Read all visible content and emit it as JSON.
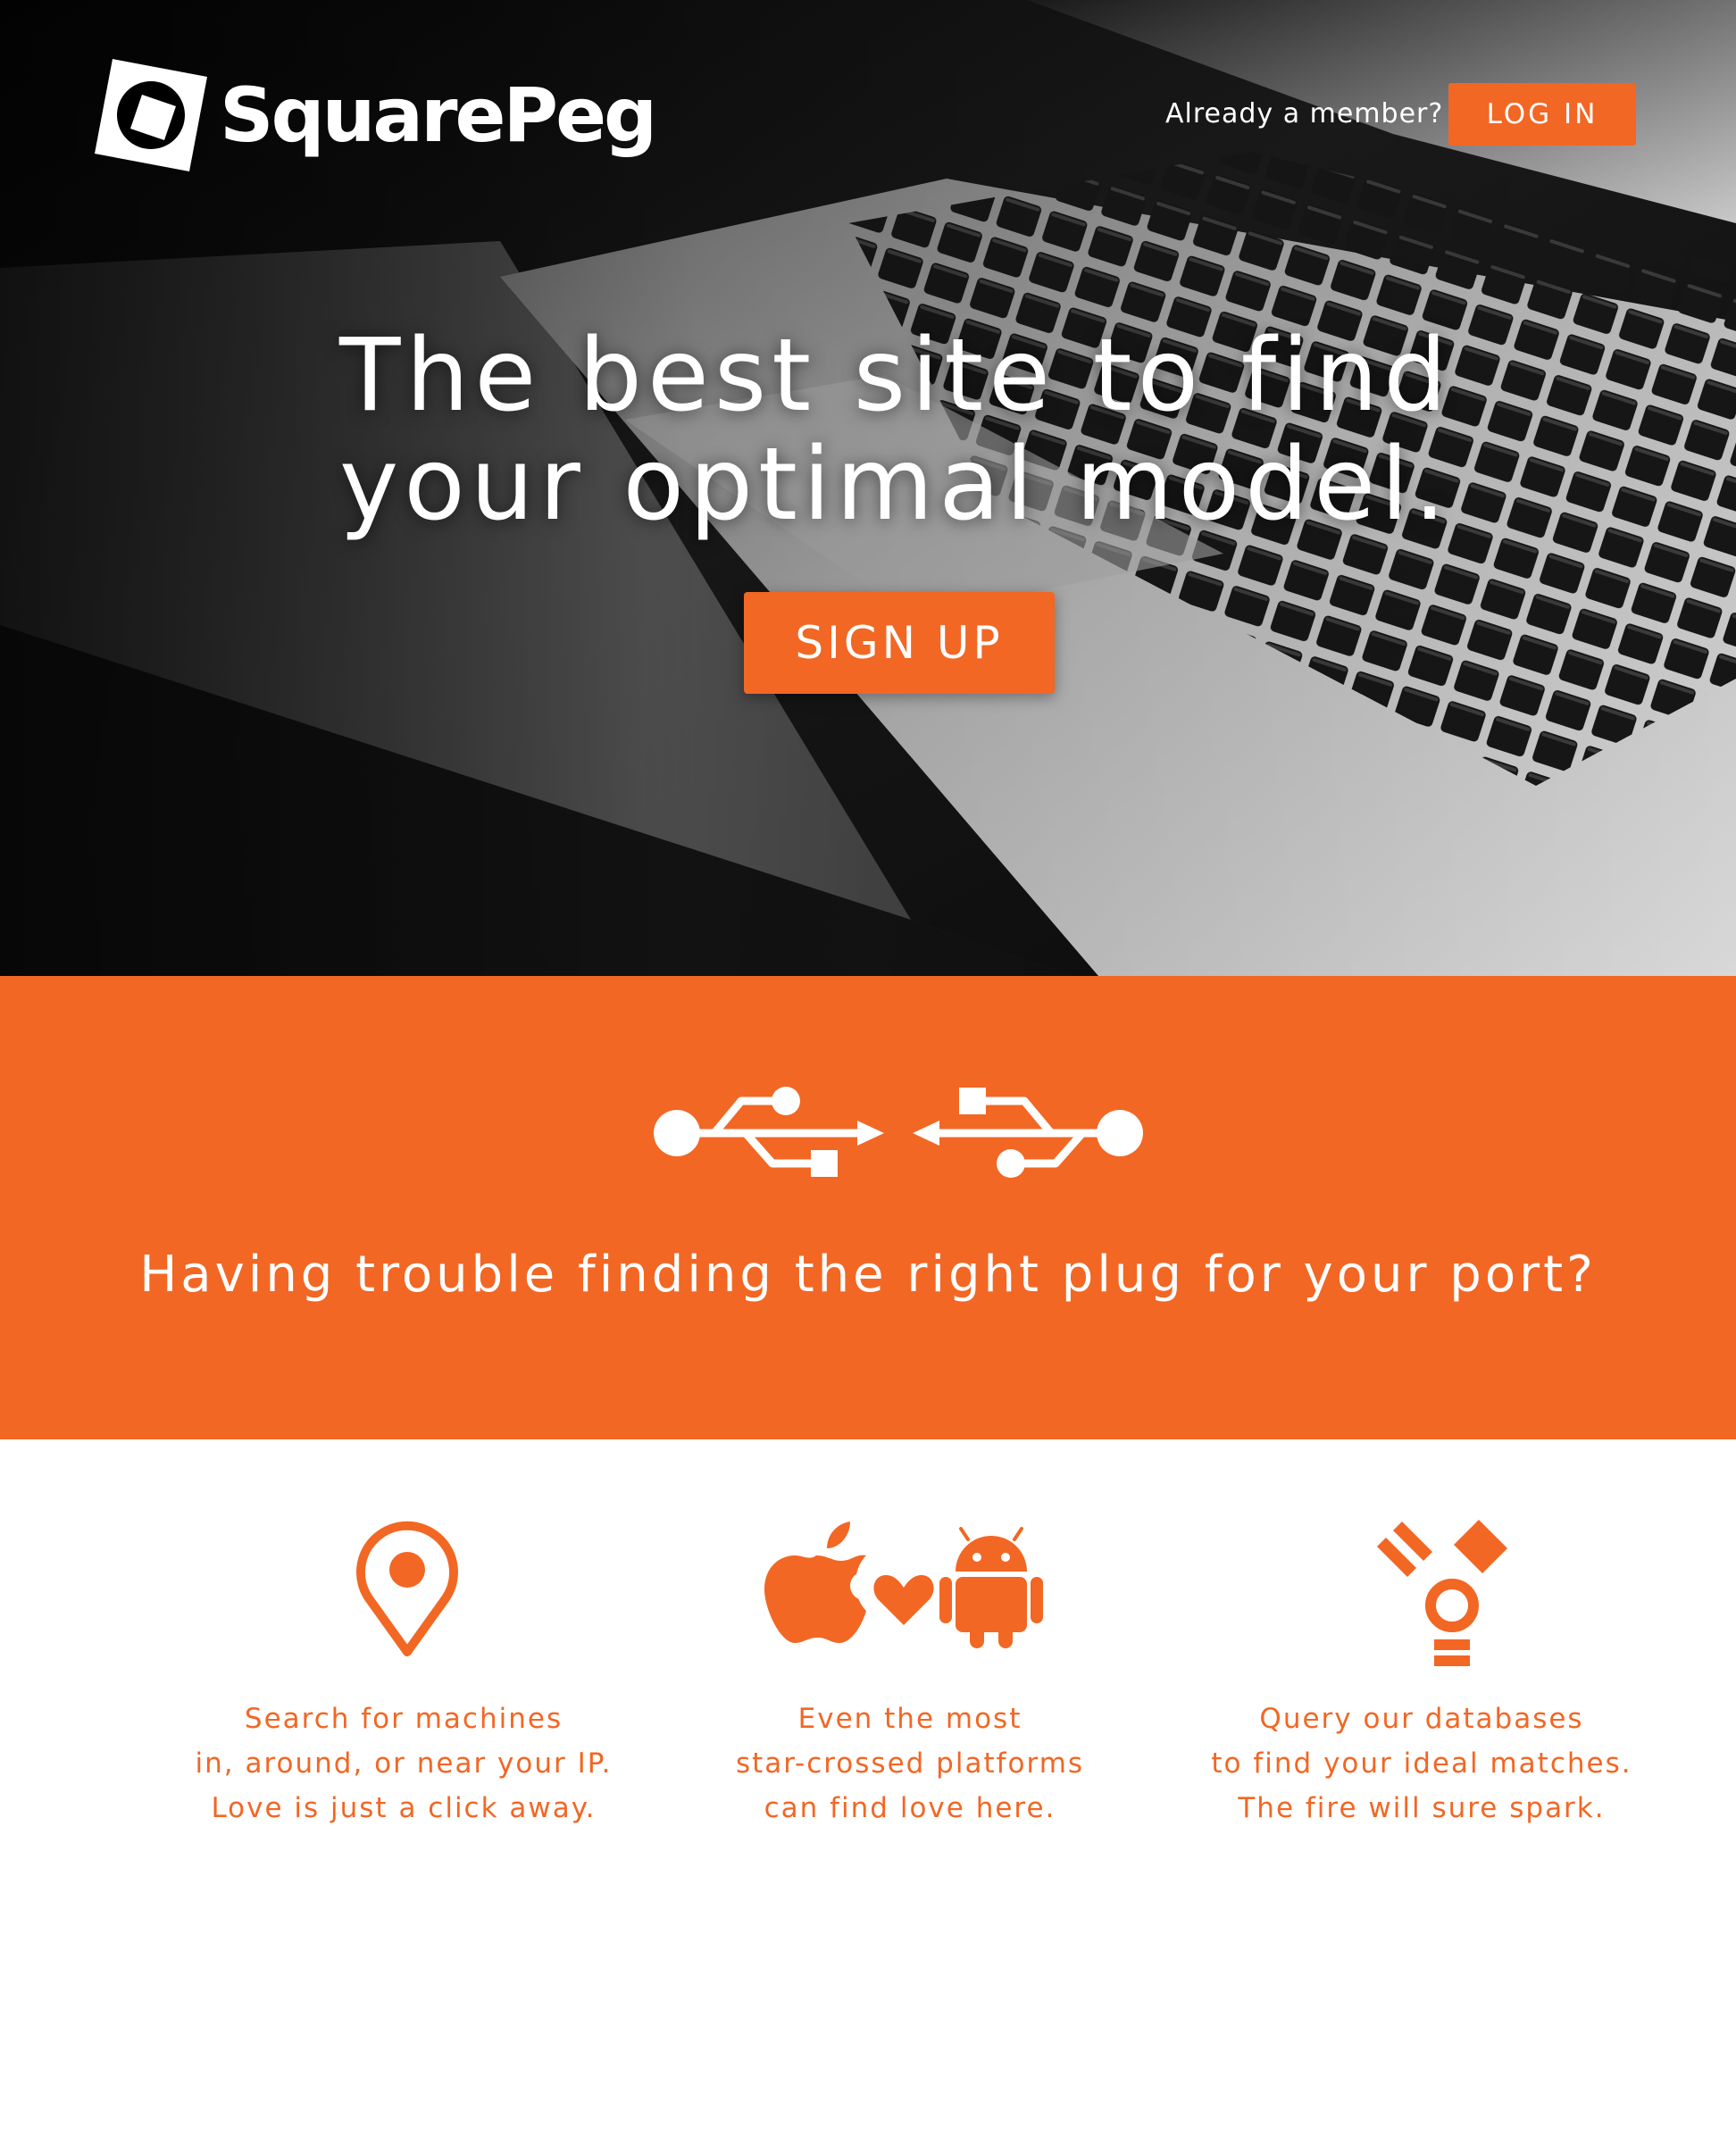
{
  "brand": {
    "name": "SquarePeg"
  },
  "header": {
    "member_prompt": "Already a member?",
    "login_label": "LOG IN"
  },
  "hero": {
    "headline_line1": "The best site to find",
    "headline_line2": "your optimal model.",
    "signup_label": "SIGN UP"
  },
  "band": {
    "icon": "usb-icon",
    "text": "Having trouble finding the right plug for your port?"
  },
  "features": [
    {
      "icon": "location-pin-icon",
      "lines": [
        "Search for machines",
        "in, around, or near your IP.",
        "Love is just a click away."
      ]
    },
    {
      "icon": "apple-heart-android-icon",
      "lines": [
        "Even the most",
        "star-crossed platforms",
        "can find love here."
      ]
    },
    {
      "icon": "firewire-icon",
      "lines": [
        "Query our databases",
        "to find your ideal matches.",
        "The fire will sure spark."
      ]
    }
  ],
  "colors": {
    "accent": "#f26724",
    "text_on_dark": "#ffffff",
    "background": "#ffffff"
  }
}
